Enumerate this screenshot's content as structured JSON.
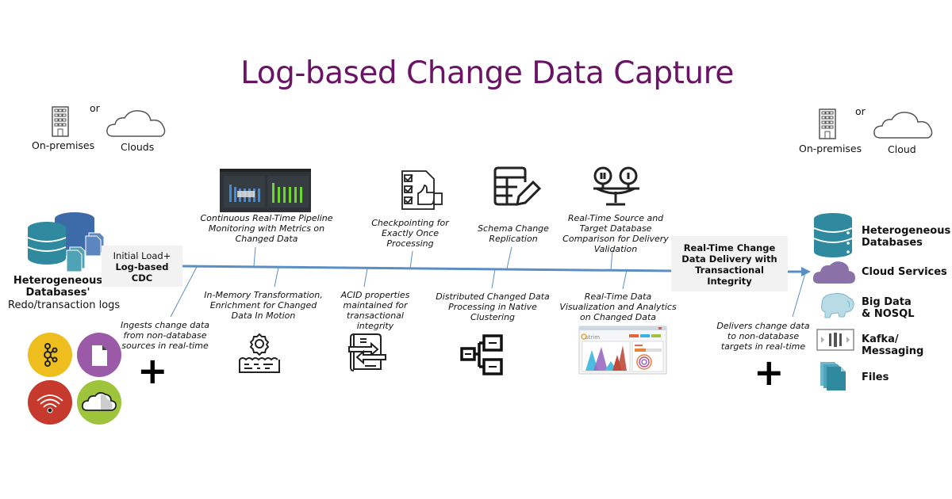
{
  "title": "Log-based Change Data Capture",
  "colors": {
    "title": "#6a1466",
    "pipeline_line": "#5b8fc4",
    "db_teal": "#2f8aa0",
    "db_blue": "#3d6aa8",
    "cloud_purple": "#8a72a8",
    "circle_yellow": "#eebd1e",
    "circle_purple": "#9a5aa8",
    "circle_red": "#c53a2c",
    "circle_green": "#9dc43a"
  },
  "source": {
    "deployment": {
      "on_premises": "On-premises",
      "or": "or",
      "clouds": "Clouds"
    },
    "db_title_line1": "Heterogeneous",
    "db_title_line2": "Databases'",
    "db_subtitle": "Redo/transaction logs",
    "initial_box": {
      "line1": "Initial Load+",
      "line2": "Log-based",
      "line3": "CDC"
    },
    "non_db_caption": "Ingests change data from non-database sources in real-time",
    "non_db_icons": [
      "kafka-icon",
      "file-icon",
      "wifi-sensor-icon",
      "cloud-icon"
    ]
  },
  "features_top": [
    {
      "icon": "dashboard-screenshot",
      "caption": "Continuous Real-Time Pipeline Monitoring with Metrics on Changed Data"
    },
    {
      "icon": "checklist-thumbs-up-icon",
      "caption": "Checkpointing for Exactly Once Processing"
    },
    {
      "icon": "table-edit-icon",
      "caption": "Schema Change Replication"
    },
    {
      "icon": "scale-compare-icon",
      "caption": "Real-Time Source and Target Database Comparison for Delivery Validation"
    }
  ],
  "features_bottom": [
    {
      "icon": "gear-water-icon",
      "caption": "In-Memory Transformation, Enrichment for Changed Data In Motion"
    },
    {
      "icon": "document-exchange-icon",
      "caption": "ACID properties maintained for transactional integrity"
    },
    {
      "icon": "cluster-hierarchy-icon",
      "caption": "Distributed  Changed Data Processing in Native Clustering"
    },
    {
      "icon": "analytics-dashboard-screenshot",
      "caption": "Real-Time Data Visualization and Analytics on Changed Data"
    }
  ],
  "delivery_box": {
    "line1": "Real-Time Change",
    "line2": "Data Delivery with",
    "line3": "Transactional",
    "line4": "Integrity"
  },
  "target": {
    "deployment": {
      "on_premises": "On-premises",
      "or": "or",
      "cloud": "Cloud"
    },
    "non_db_caption": "Delivers change data to non-database targets in real-time",
    "items": [
      {
        "icon": "database-icon",
        "line1": "Heterogeneous",
        "line2": "Databases"
      },
      {
        "icon": "cloud-services-icon",
        "line1": "Cloud Services",
        "line2": ""
      },
      {
        "icon": "hadoop-elephant-icon",
        "line1": "Big Data",
        "line2": "& NOSQL"
      },
      {
        "icon": "kafka-messaging-icon",
        "line1": "Kafka/",
        "line2": "Messaging"
      },
      {
        "icon": "files-icon",
        "line1": "Files",
        "line2": ""
      }
    ]
  },
  "plus_symbol": "+"
}
